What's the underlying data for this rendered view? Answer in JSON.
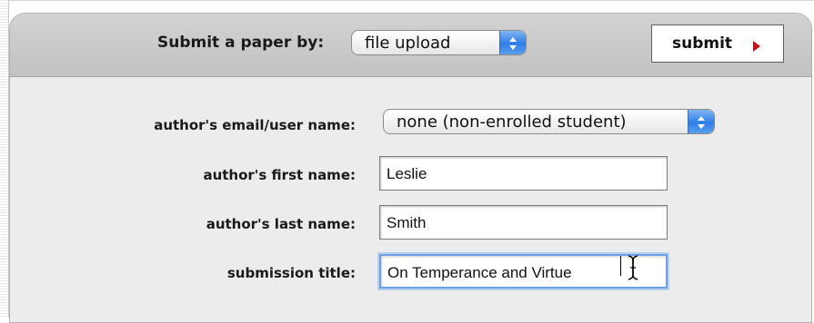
{
  "header": {
    "submit_by_label": "Submit a paper by:",
    "submit_by_value": "file upload",
    "submit_button_label": "submit"
  },
  "form": {
    "email": {
      "label": "author's email/user name:",
      "value": "none (non-enrolled student)"
    },
    "first_name": {
      "label": "author's first name:",
      "value": "Leslie"
    },
    "last_name": {
      "label": "author's last name:",
      "value": "Smith"
    },
    "title": {
      "label": "submission title:",
      "value": "On Temperance and Virtue"
    }
  },
  "colors": {
    "panel_background": "#ececec",
    "header_background": "#c8c8c8",
    "select_stepper": "#2f7ee6",
    "submit_arrow": "#c0141b",
    "focus_ring": "#6fa0e3"
  },
  "icons": {
    "stepper": "up-down-arrows-icon",
    "submit_arrow": "triangle-right-icon",
    "cursor": "ibeam-cursor-icon"
  }
}
